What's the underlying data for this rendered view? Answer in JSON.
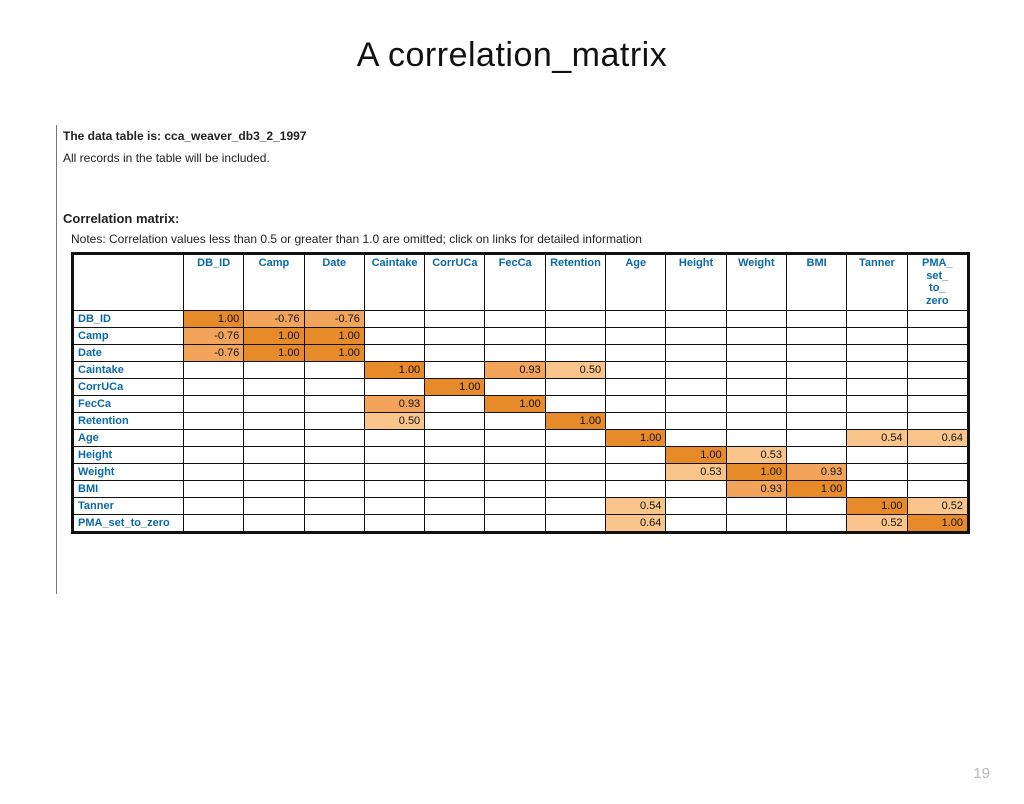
{
  "slide": {
    "title": "A correlation_matrix",
    "page_number": "19"
  },
  "intro": {
    "dt_label": "The data table is: ",
    "dt_name": "cca_weaver_db3_2_1997",
    "all_records": "All records in the table will be included.",
    "section_label": "Correlation matrix:",
    "notes": "Notes: Correlation values less than 0.5 or greater than 1.0 are omitted; click on links for detailed information"
  },
  "variables": [
    "DB_ID",
    "Camp",
    "Date",
    "Caintake",
    "CorrUCa",
    "FecCa",
    "Retention",
    "Age",
    "Height",
    "Weight",
    "BMI",
    "Tanner",
    "PMA_ set_ to_ zero"
  ],
  "row_labels": [
    "DB_ID",
    "Camp",
    "Date",
    "Caintake",
    "CorrUCa",
    "FecCa",
    "Retention",
    "Age",
    "Height",
    "Weight",
    "BMI",
    "Tanner",
    "PMA_set_to_zero"
  ],
  "matrix": [
    [
      "1.00",
      "-0.76",
      "-0.76",
      "",
      "",
      "",
      "",
      "",
      "",
      "",
      "",
      "",
      ""
    ],
    [
      "-0.76",
      "1.00",
      "1.00",
      "",
      "",
      "",
      "",
      "",
      "",
      "",
      "",
      "",
      ""
    ],
    [
      "-0.76",
      "1.00",
      "1.00",
      "",
      "",
      "",
      "",
      "",
      "",
      "",
      "",
      "",
      ""
    ],
    [
      "",
      "",
      "",
      "1.00",
      "",
      "0.93",
      "0.50",
      "",
      "",
      "",
      "",
      "",
      ""
    ],
    [
      "",
      "",
      "",
      "",
      "1.00",
      "",
      "",
      "",
      "",
      "",
      "",
      "",
      ""
    ],
    [
      "",
      "",
      "",
      "0.93",
      "",
      "1.00",
      "",
      "",
      "",
      "",
      "",
      "",
      ""
    ],
    [
      "",
      "",
      "",
      "0.50",
      "",
      "",
      "1.00",
      "",
      "",
      "",
      "",
      "",
      ""
    ],
    [
      "",
      "",
      "",
      "",
      "",
      "",
      "",
      "1.00",
      "",
      "",
      "",
      "0.54",
      "0.64"
    ],
    [
      "",
      "",
      "",
      "",
      "",
      "",
      "",
      "",
      "1.00",
      "0.53",
      "",
      "",
      ""
    ],
    [
      "",
      "",
      "",
      "",
      "",
      "",
      "",
      "",
      "0.53",
      "1.00",
      "0.93",
      "",
      ""
    ],
    [
      "",
      "",
      "",
      "",
      "",
      "",
      "",
      "",
      "",
      "0.93",
      "1.00",
      "",
      ""
    ],
    [
      "",
      "",
      "",
      "",
      "",
      "",
      "",
      "0.54",
      "",
      "",
      "",
      "1.00",
      "0.52"
    ],
    [
      "",
      "",
      "",
      "",
      "",
      "",
      "",
      "0.64",
      "",
      "",
      "",
      "0.52",
      "1.00"
    ]
  ]
}
